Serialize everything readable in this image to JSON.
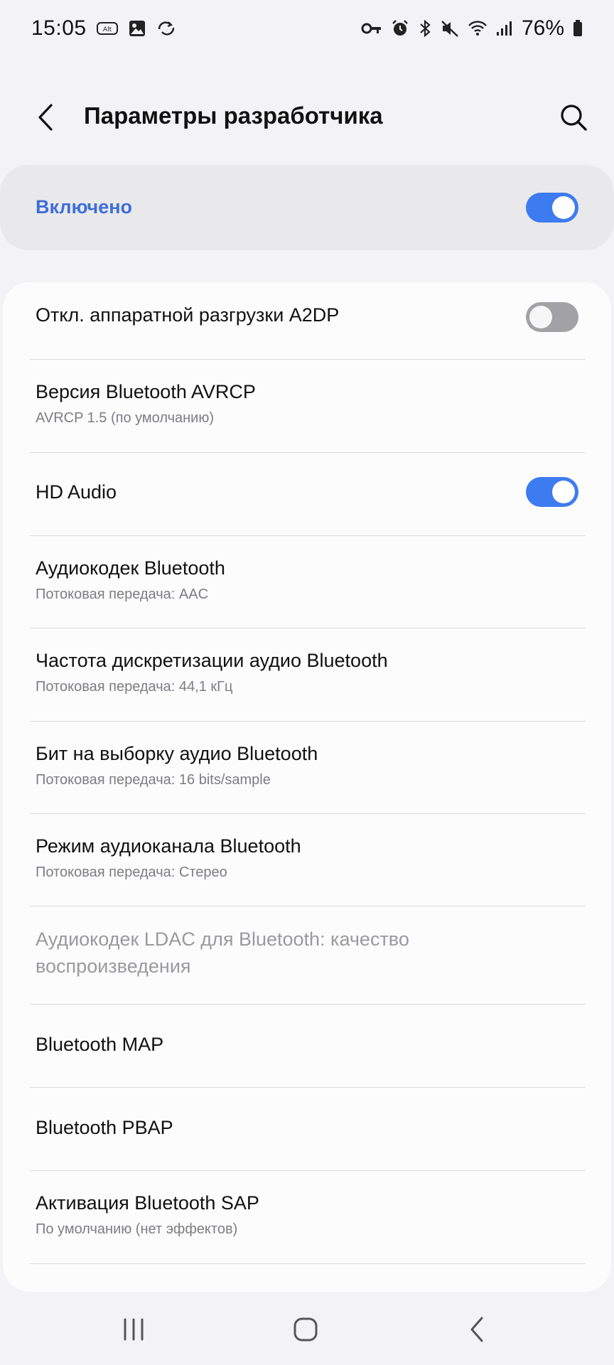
{
  "status_bar": {
    "time": "15:05",
    "battery": "76%",
    "left_icons": [
      "alt-icon",
      "gallery-icon",
      "sync-icon"
    ],
    "right_icons": [
      "key-icon",
      "alarm-icon",
      "bluetooth-icon",
      "mute-icon",
      "wifi-icon",
      "signal-icon",
      "battery-icon"
    ]
  },
  "header": {
    "title": "Параметры разработчика",
    "back_icon": "chevron-left-icon",
    "search_icon": "search-icon"
  },
  "master": {
    "label": "Включено",
    "enabled": true,
    "accent": "#3f6ed8"
  },
  "items": [
    {
      "label": "Откл. аппаратной разгрузки A2DP",
      "toggle": false
    },
    {
      "label": "Версия Bluetooth AVRCP",
      "sub": "AVRCP 1.5 (по умолчанию)"
    },
    {
      "label": "HD Audio",
      "toggle": true
    },
    {
      "label": "Аудиокодек Bluetooth",
      "sub": "Потоковая передача: AAC"
    },
    {
      "label": "Частота дискретизации аудио Bluetooth",
      "sub": "Потоковая передача: 44,1 кГц"
    },
    {
      "label": "Бит на выборку аудио Bluetooth",
      "sub": "Потоковая передача: 16 bits/sample"
    },
    {
      "label": "Режим аудиоканала Bluetooth",
      "sub": "Потоковая передача: Стерео"
    },
    {
      "label": "Аудиокодек LDAC для Bluetooth: качество воспроизведения",
      "disabled": true
    },
    {
      "label": "Bluetooth MAP"
    },
    {
      "label": "Bluetooth PBAP"
    },
    {
      "label": "Активация Bluetooth SAP",
      "sub": "По умолчанию (нет эффектов)"
    }
  ],
  "nav_bar": {
    "icons": [
      "recent-apps-icon",
      "home-icon",
      "back-icon"
    ]
  },
  "colors": {
    "toggle_on": "#3d7bf0",
    "toggle_off": "#a2a2a6"
  }
}
